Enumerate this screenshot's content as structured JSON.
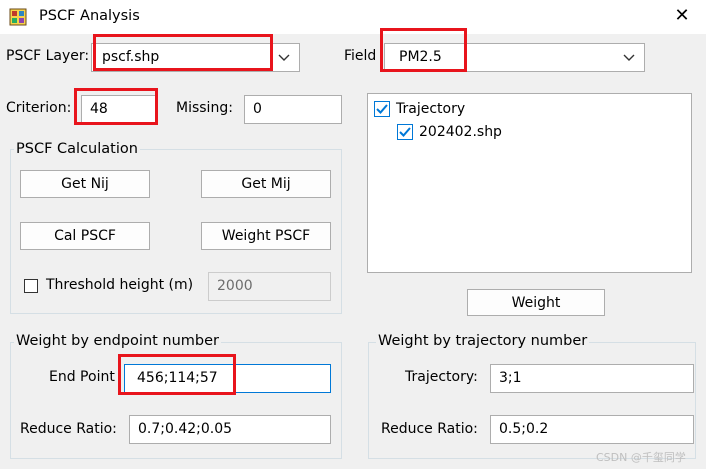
{
  "window": {
    "title": "PSCF Analysis",
    "close_glyph": "✕"
  },
  "layer": {
    "label": "PSCF Layer:",
    "value": "pscf.shp"
  },
  "field": {
    "label": "Field",
    "value": "PM2.5"
  },
  "criterion": {
    "label": "Criterion:",
    "value": "48"
  },
  "missing": {
    "label": "Missing:",
    "value": "0"
  },
  "calculation": {
    "title": "PSCF Calculation",
    "get_nij": "Get Nij",
    "get_mij": "Get Mij",
    "cal_pscf": "Cal PSCF",
    "weight_pscf": "Weight PSCF",
    "threshold_label": "Threshold height (m)",
    "threshold_checked": false,
    "threshold_value": "2000"
  },
  "tree": {
    "root": {
      "label": "Trajectory",
      "checked": true
    },
    "child": {
      "label": "202402.shp",
      "checked": true
    }
  },
  "weight_button": "Weight",
  "endpoint_group": {
    "title": "Weight by endpoint number",
    "end_point_label": "End Point",
    "end_point_value": "456;114;57",
    "reduce_label": "Reduce Ratio:",
    "reduce_value": "0.7;0.42;0.05"
  },
  "trajectory_group": {
    "title": "Weight by trajectory number",
    "trajectory_label": "Trajectory:",
    "trajectory_value": "3;1",
    "reduce_label": "Reduce Ratio:",
    "reduce_value": "0.5;0.2"
  },
  "watermark": "CSDN @千玺同学",
  "colors": {
    "highlight": "#e8141c",
    "accent": "#0078d7"
  },
  "icons": [
    "app-icon",
    "close-icon",
    "chevron-down-icon",
    "checkbox-icon"
  ]
}
